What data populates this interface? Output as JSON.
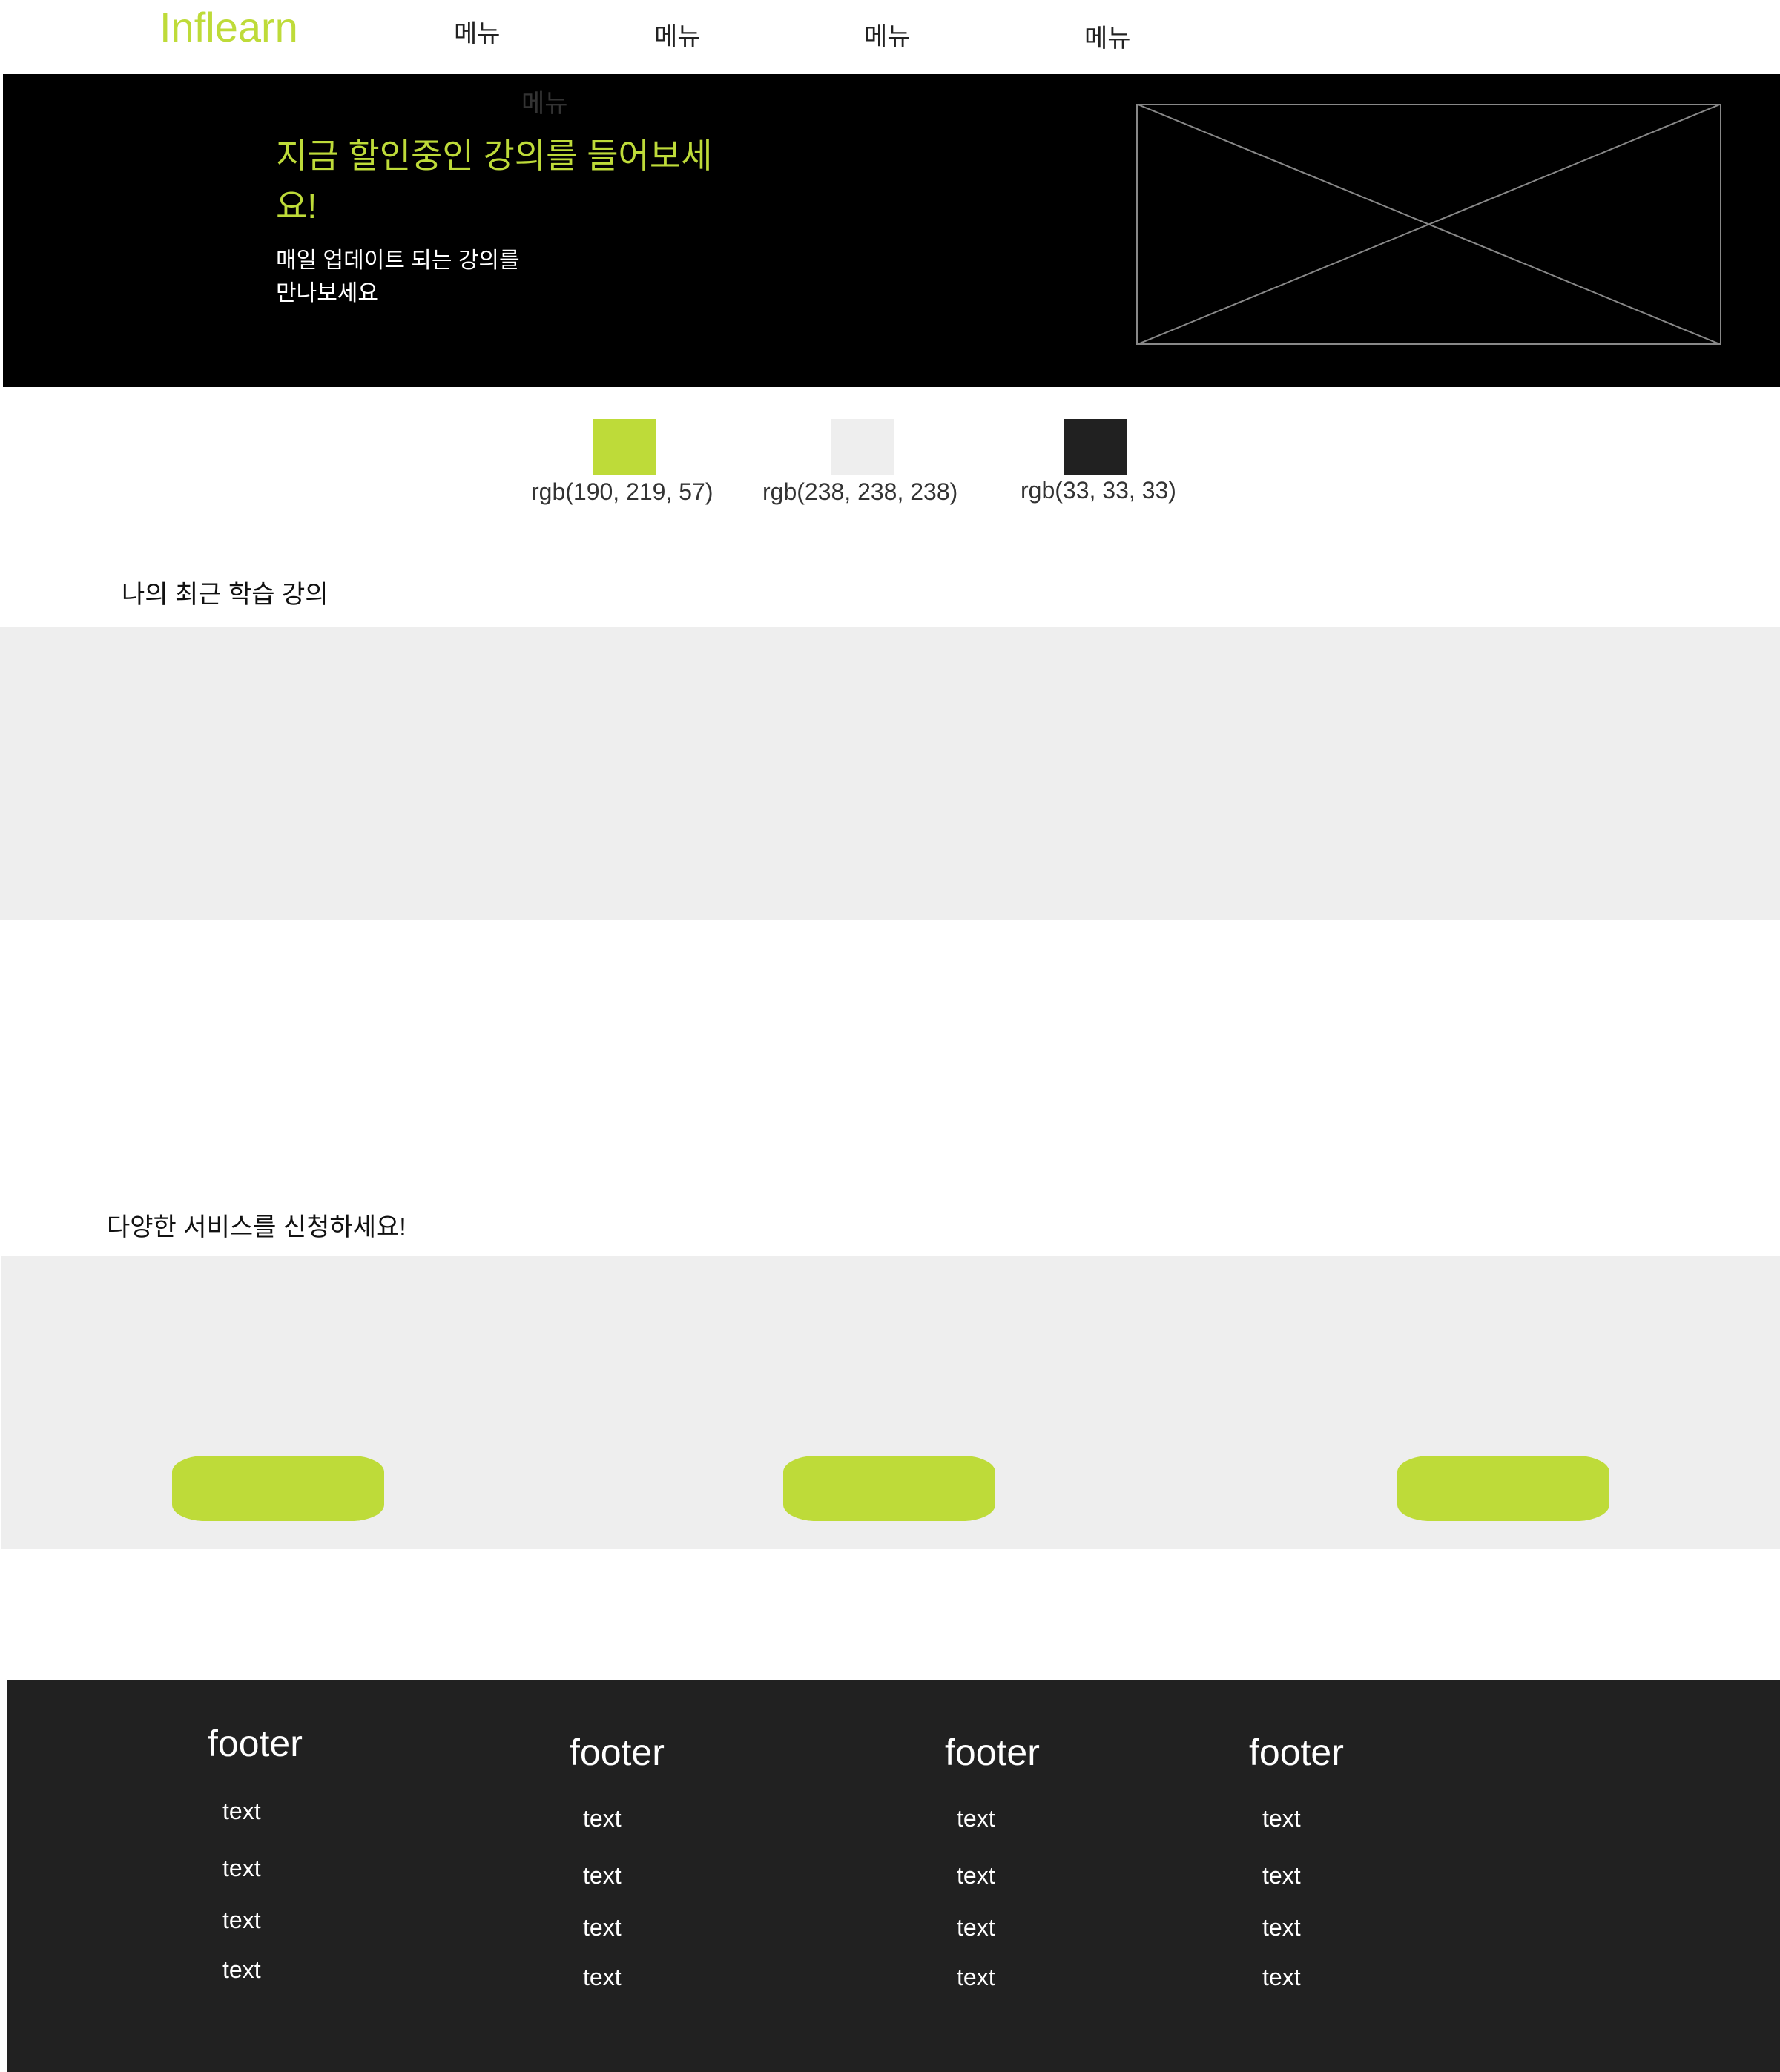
{
  "header": {
    "logo": "Inflearn",
    "menu": [
      "메뉴",
      "메뉴",
      "메뉴",
      "메뉴"
    ],
    "submenu": "메뉴"
  },
  "hero": {
    "title": "지금 할인중인 강의를 들어보세요!",
    "subtitle_lines": [
      "매일 업데이트 되는 강의를",
      "만나보세요"
    ],
    "image_placeholder": "image-placeholder"
  },
  "palette": [
    {
      "color": "#bedb39",
      "label": "rgb(190, 219, 57)"
    },
    {
      "color": "#eeeeee",
      "label": "rgb(238, 238, 238)"
    },
    {
      "color": "#212121",
      "label": "rgb(33, 33, 33)"
    }
  ],
  "recent": {
    "title": "나의 최근 학습 강의"
  },
  "services": {
    "title": "다양한 서비스를 신청하세요!",
    "button_count": 3
  },
  "footer": {
    "columns": [
      {
        "heading": "footer",
        "items": [
          "text",
          "text",
          "text",
          "text"
        ]
      },
      {
        "heading": "footer",
        "items": [
          "text",
          "text",
          "text",
          "text"
        ]
      },
      {
        "heading": "footer",
        "items": [
          "text",
          "text",
          "text",
          "text"
        ]
      },
      {
        "heading": "footer",
        "items": [
          "text",
          "text",
          "text",
          "text"
        ]
      }
    ]
  }
}
